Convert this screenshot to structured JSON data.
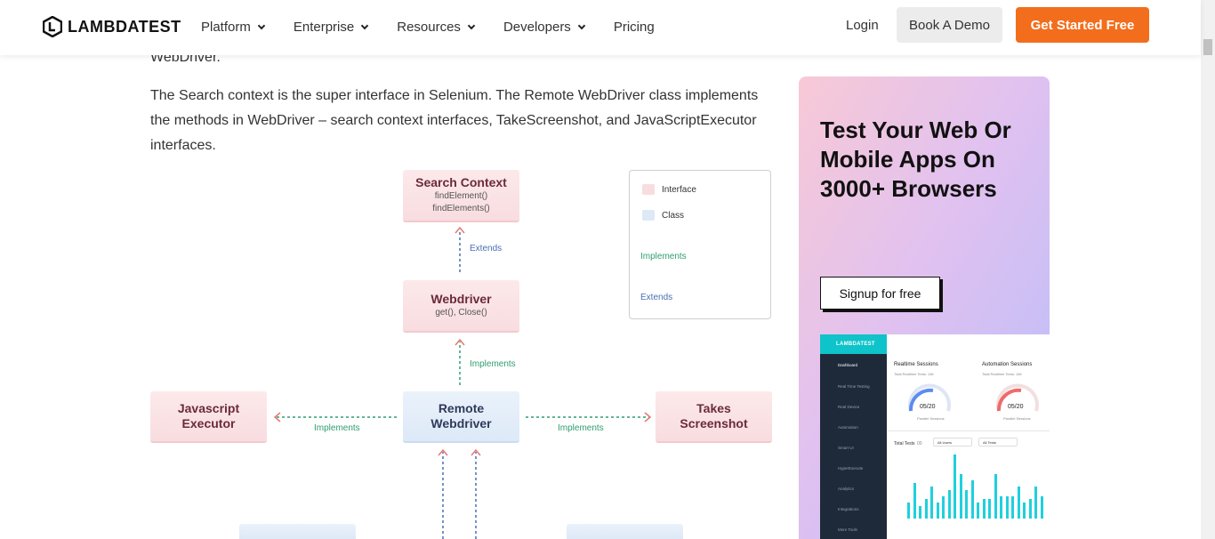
{
  "nav": {
    "logo": "LAMBDATEST",
    "menu": [
      {
        "label": "Platform",
        "has_dropdown": true
      },
      {
        "label": "Enterprise",
        "has_dropdown": true
      },
      {
        "label": "Resources",
        "has_dropdown": true
      },
      {
        "label": "Developers",
        "has_dropdown": true
      },
      {
        "label": "Pricing",
        "has_dropdown": false
      }
    ],
    "login": "Login",
    "demo_button": "Book A Demo",
    "start_button": "Get Started Free",
    "accent_color": "#f26e1d"
  },
  "article": {
    "partial_line": "WebDriver.",
    "paragraph": "The Search context is the super interface in Selenium. The Remote WebDriver class implements the methods in WebDriver – search context interfaces, TakeScreenshot, and JavaScriptExecutor interfaces."
  },
  "diagram": {
    "search_context": {
      "title": "Search Context",
      "methods": [
        "findElement()",
        "findElements()"
      ]
    },
    "webdriver": {
      "title": "Webdriver",
      "methods": "get(), Close()"
    },
    "remote": {
      "title_1": "Remote",
      "title_2": "Webdriver"
    },
    "javascript": {
      "title_1": "Javascript",
      "title_2": "Executor"
    },
    "takes": {
      "title_1": "Takes",
      "title_2": "Screenshot"
    },
    "labels": {
      "extends": "Extends",
      "implements": "Implements"
    },
    "legend": {
      "interface": "Interface",
      "class": "Class",
      "implements": "Implements",
      "extends": "Extends"
    },
    "colors": {
      "interface": "#f8dde0",
      "class": "#dde9f7",
      "implements": "#2f9e6e",
      "extends": "#4a6fb5",
      "arrow": "#e07a72"
    }
  },
  "sidebar": {
    "title": "Test Your Web Or Mobile Apps On 3000+ Browsers",
    "signup_button": "Signup for free",
    "dashboard": {
      "brand": "LAMBDATEST",
      "menu": [
        "Dashboard",
        "Real Time Testing",
        "Real Device",
        "Automation",
        "Smart UI",
        "HyperExecute",
        "Analytics",
        "Integrations",
        "More Tools"
      ],
      "realtime_title": "Realtime Sessions",
      "realtime_sub": "Total Realtime Tests: 136",
      "automation_title": "Automation Sessions",
      "automation_sub": "Total Realtime Tests: 136",
      "realtime_gauge": "05/20",
      "automation_gauge": "05/20",
      "gauge_caption": "Parallel Sessions",
      "tests_label": "Total Tests",
      "tests_count": "00",
      "filter_users": "All Users",
      "filter_tests": "All Tests",
      "chart_values": [
        0.25,
        0.55,
        0.2,
        0.3,
        0.5,
        0.25,
        0.35,
        0.45,
        1.0,
        0.7,
        0.45,
        0.6,
        0.25,
        0.3,
        0.3,
        0.7,
        0.35,
        0.35,
        0.35,
        0.5,
        0.25,
        0.3,
        0.5,
        0.35
      ]
    }
  }
}
